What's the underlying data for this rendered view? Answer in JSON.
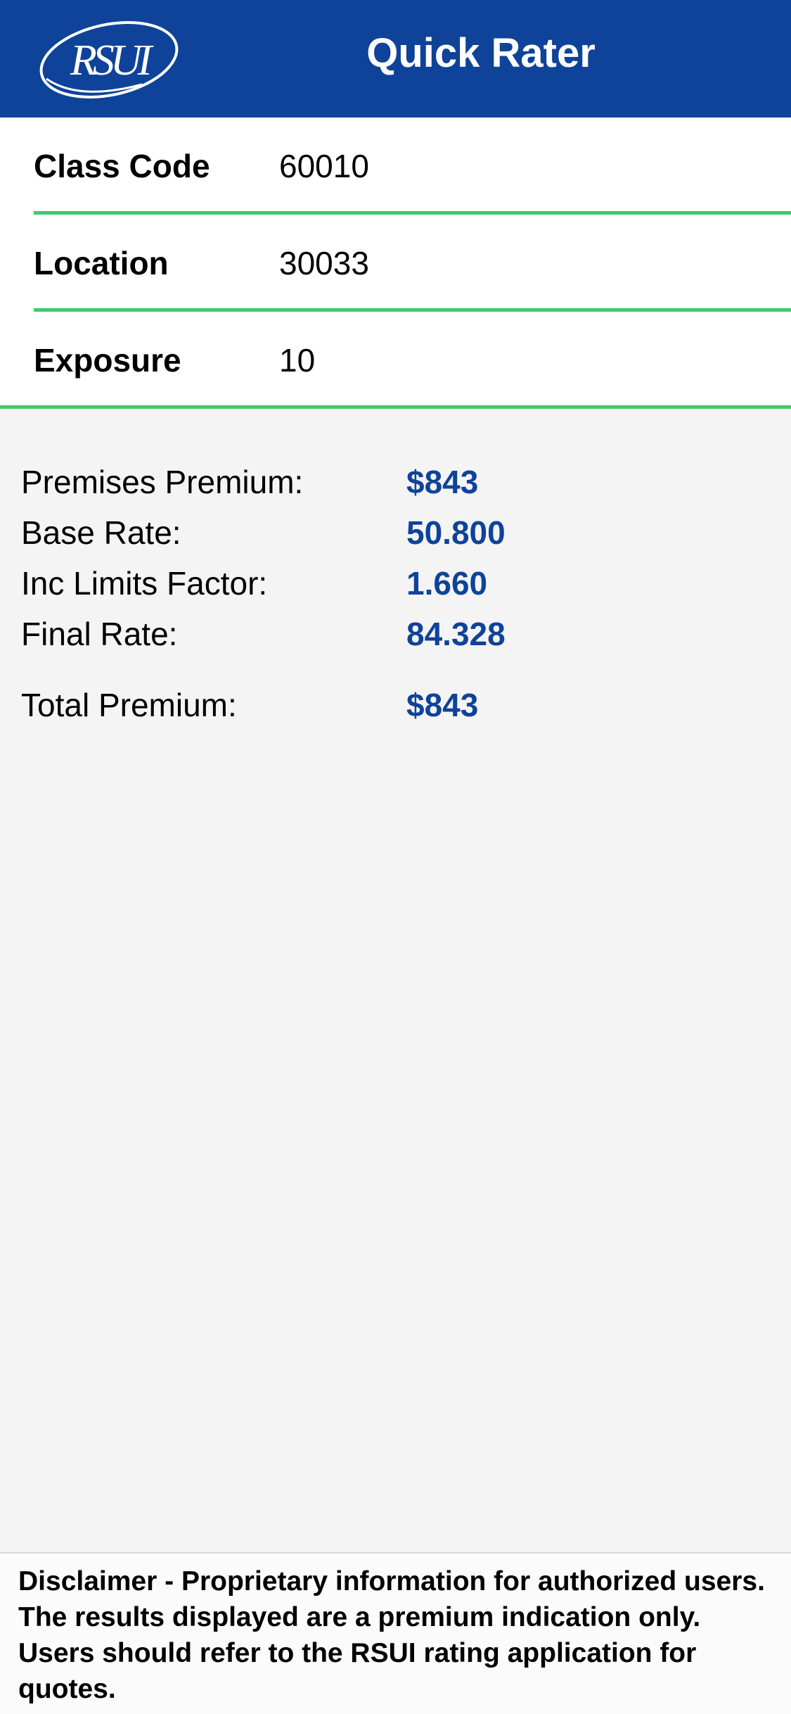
{
  "header": {
    "logo_text": "RSUI",
    "title": "Quick Rater"
  },
  "form": {
    "class_code": {
      "label": "Class Code",
      "value": "60010"
    },
    "location": {
      "label": "Location",
      "value": "30033"
    },
    "exposure": {
      "label": "Exposure",
      "value": "10"
    }
  },
  "results": {
    "premises_premium": {
      "label": "Premises Premium:",
      "value": "$843"
    },
    "base_rate": {
      "label": "Base Rate:",
      "value": "50.800"
    },
    "inc_limits_factor": {
      "label": "Inc Limits Factor:",
      "value": "1.660"
    },
    "final_rate": {
      "label": "Final Rate:",
      "value": "84.328"
    },
    "total_premium": {
      "label": "Total Premium:",
      "value": "$843"
    }
  },
  "disclaimer": {
    "text": "Disclaimer - Proprietary information for authorized users. The results displayed are a premium indication only. Users should refer to the RSUI rating application for quotes."
  },
  "colors": {
    "header_bg": "#0e4399",
    "accent_green": "#3ecb6a",
    "value_blue": "#0e4399",
    "page_bg": "#f4f4f4"
  },
  "icons": {
    "logo": "rsui-logo"
  }
}
